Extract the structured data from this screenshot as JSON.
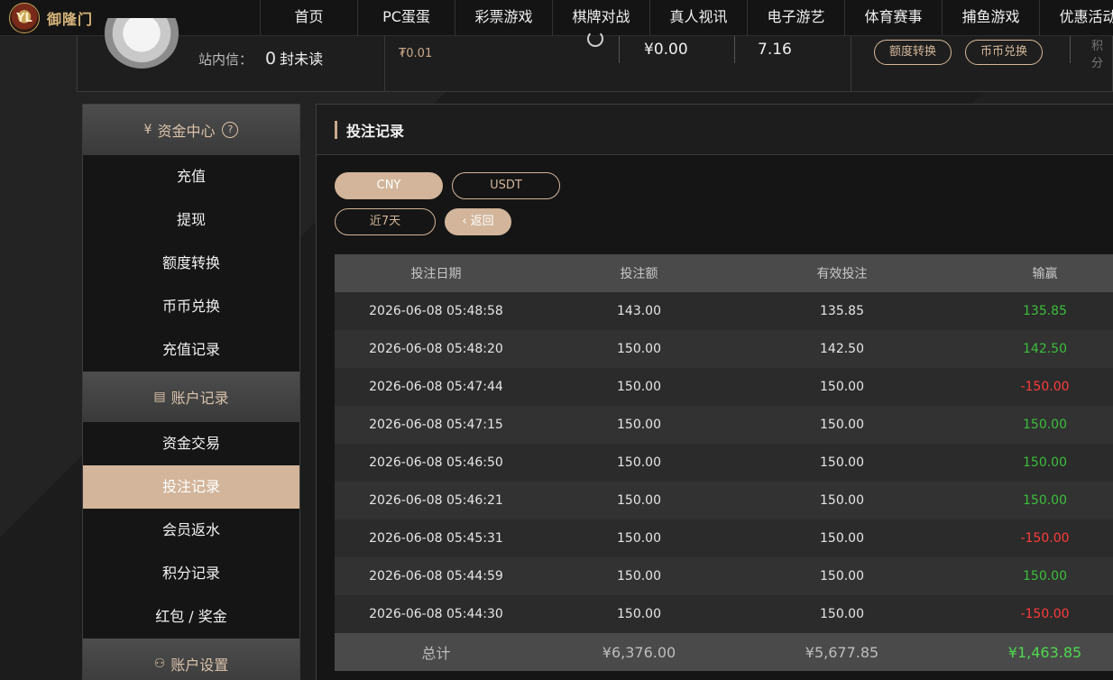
{
  "brand": {
    "logo_text": "御隆门",
    "logo_mark": "YL"
  },
  "nav": [
    "首页",
    "PC蛋蛋",
    "彩票游戏",
    "棋牌对战",
    "真人视讯",
    "电子游艺",
    "体育赛事",
    "捕鱼游戏",
    "优惠活动"
  ],
  "user": {
    "inbox_label": "站内信：",
    "inbox_count": "0",
    "inbox_unit": "封未读",
    "small_amount": "₮0.01",
    "balance": "¥0.00",
    "points": "7.16",
    "transfer_btn": "额度转换",
    "exchange_btn": "币币兑换",
    "edge_text": "积分"
  },
  "sidebar": {
    "fund_center": "资金中心",
    "fund_items": [
      "充值",
      "提现",
      "额度转换",
      "币币兑换",
      "充值记录"
    ],
    "account_records": "账户记录",
    "record_items": [
      "资金交易",
      "投注记录",
      "会员返水",
      "积分记录",
      "红包 / 奖金"
    ],
    "account_settings": "账户设置",
    "active_item": "投注记录"
  },
  "main": {
    "title": "投注记录",
    "currency_tabs": [
      "CNY",
      "USDT"
    ],
    "active_currency": "CNY",
    "period_label": "近7天",
    "back_label": "返回"
  },
  "table": {
    "headers": [
      "投注日期",
      "投注额",
      "有效投注",
      "输赢"
    ],
    "rows": [
      [
        "2026-06-08 05:48:58",
        "143.00",
        "135.85",
        "135.85"
      ],
      [
        "2026-06-08 05:48:20",
        "150.00",
        "142.50",
        "142.50"
      ],
      [
        "2026-06-08 05:47:44",
        "150.00",
        "150.00",
        "-150.00"
      ],
      [
        "2026-06-08 05:47:15",
        "150.00",
        "150.00",
        "150.00"
      ],
      [
        "2026-06-08 05:46:50",
        "150.00",
        "150.00",
        "150.00"
      ],
      [
        "2026-06-08 05:46:21",
        "150.00",
        "150.00",
        "150.00"
      ],
      [
        "2026-06-08 05:45:31",
        "150.00",
        "150.00",
        "-150.00"
      ],
      [
        "2026-06-08 05:44:59",
        "150.00",
        "150.00",
        "150.00"
      ],
      [
        "2026-06-08 05:44:30",
        "150.00",
        "150.00",
        "-150.00"
      ]
    ],
    "footer": [
      "总计",
      "¥6,376.00",
      "¥5,677.85",
      "¥1,463.85"
    ]
  },
  "colors": {
    "accent": "#d2b59a",
    "win": "#3bbf3b",
    "loss": "#ff3b3b"
  }
}
